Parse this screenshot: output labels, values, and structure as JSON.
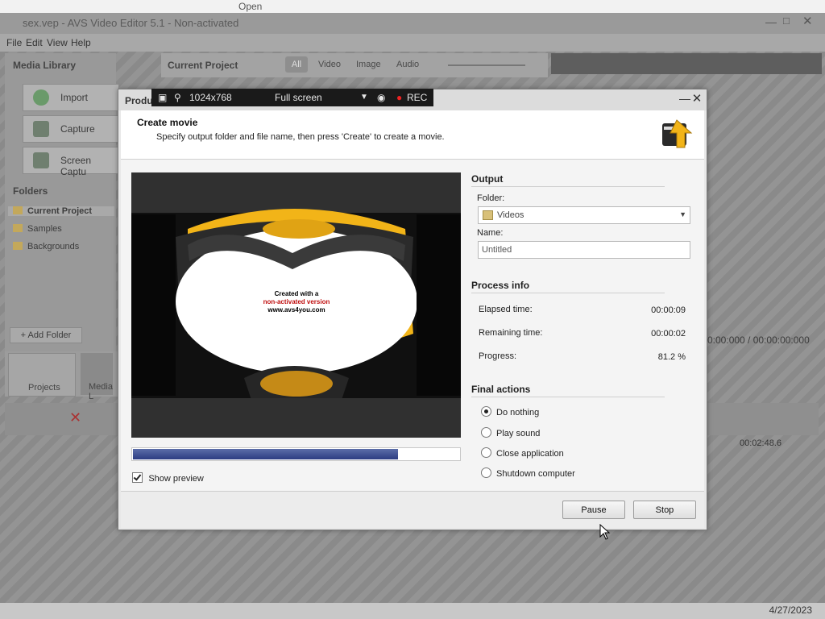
{
  "browser_tab": {
    "title": "Open"
  },
  "app": {
    "title": "sex.vep - AVS Video Editor 5.1 - Non-activated",
    "menu": [
      "File",
      "Edit",
      "View",
      "Help"
    ],
    "media_library": {
      "title": "Media Library",
      "buttons": [
        "Import",
        "Capture",
        "Screen Captu"
      ],
      "folders_title": "Folders",
      "folders": [
        "Current Project",
        "Samples",
        "Backgrounds"
      ],
      "add_folder": "+ Add Folder"
    },
    "current_project": {
      "title": "Current Project",
      "filters": [
        "All",
        "Video",
        "Image",
        "Audio"
      ]
    },
    "bottom_tabs": [
      "Projects",
      "Media L"
    ],
    "time_readout": "0:00:000 / 00:00:00:000",
    "timeline_time": "00:02:48.6",
    "taskbar_date": "4/27/2023"
  },
  "recorder": {
    "resolution": "1024x768",
    "mode": "Full screen",
    "rec_label": "REC"
  },
  "dialog": {
    "title": "Produ",
    "heading": "Create movie",
    "subtitle": "Specify output folder and file name, then press 'Create' to create a movie.",
    "preview": {
      "watermark_lines": [
        "Created with a",
        "non-activated version",
        "www.avs4you.com"
      ]
    },
    "progress_percent": 81.2,
    "show_preview": {
      "label": "Show preview",
      "checked": true
    },
    "output": {
      "section_title": "Output",
      "folder_label": "Folder:",
      "folder_value": "Videos",
      "name_label": "Name:",
      "name_value": "Untitled"
    },
    "process_info": {
      "section_title": "Process info",
      "elapsed_label": "Elapsed time:",
      "elapsed_value": "00:00:09",
      "remaining_label": "Remaining time:",
      "remaining_value": "00:00:02",
      "progress_label": "Progress:",
      "progress_value": "81.2 %"
    },
    "final_actions": {
      "section_title": "Final actions",
      "options": [
        "Do nothing",
        "Play sound",
        "Close application",
        "Shutdown computer"
      ],
      "selected": "Do nothing"
    },
    "buttons": {
      "pause": "Pause",
      "stop": "Stop"
    }
  }
}
